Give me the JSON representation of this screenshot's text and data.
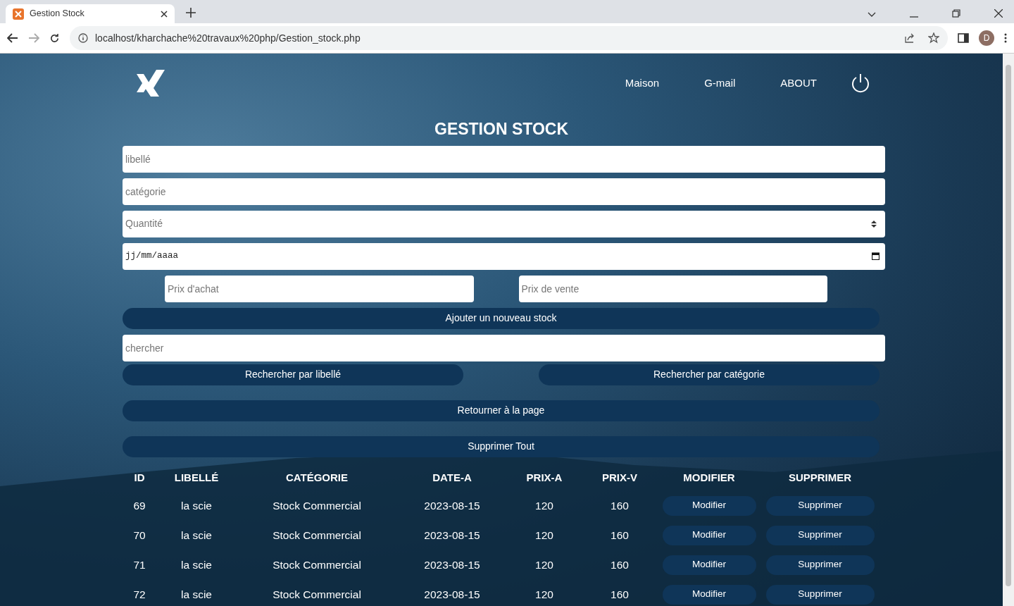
{
  "browser": {
    "tab_title": "Gestion Stock",
    "url": "localhost/kharchache%20travaux%20php/Gestion_stock.php",
    "profile_initial": "D"
  },
  "nav": {
    "links": [
      "Maison",
      "G-mail",
      "ABOUT"
    ]
  },
  "title": "GESTION STOCK",
  "fields": [
    {
      "kind": "text",
      "placeholder": "libellé"
    },
    {
      "kind": "text",
      "placeholder": "catégorie"
    },
    {
      "kind": "number",
      "placeholder": "Quantité"
    },
    {
      "kind": "date",
      "placeholder": "jj/mm/aaaa"
    }
  ],
  "price_fields": [
    {
      "placeholder": "Prix d'achat"
    },
    {
      "placeholder": "Prix de vente"
    }
  ],
  "add_button": "Ajouter un nouveau stock",
  "search": {
    "placeholder": "chercher"
  },
  "search_buttons": [
    "Rechercher par libellé",
    "Rechercher par catégorie"
  ],
  "return_button": "Retourner à la page",
  "delete_all_button": "Supprimer Tout",
  "table": {
    "columns": [
      "ID",
      "LIBELLÉ",
      "CATÉGORIE",
      "DATE-A",
      "PRIX-A",
      "PRIX-V",
      "MODIFIER",
      "SUPPRIMER"
    ],
    "rows": [
      {
        "id": "69",
        "libelle": "la scie",
        "categorie": "Stock Commercial",
        "date": "2023-08-15",
        "prix_a": "120",
        "prix_v": "160",
        "edit": "Modifier",
        "delete": "Supprimer"
      },
      {
        "id": "70",
        "libelle": "la scie",
        "categorie": "Stock Commercial",
        "date": "2023-08-15",
        "prix_a": "120",
        "prix_v": "160",
        "edit": "Modifier",
        "delete": "Supprimer"
      },
      {
        "id": "71",
        "libelle": "la scie",
        "categorie": "Stock Commercial",
        "date": "2023-08-15",
        "prix_a": "120",
        "prix_v": "160",
        "edit": "Modifier",
        "delete": "Supprimer"
      },
      {
        "id": "72",
        "libelle": "la scie",
        "categorie": "Stock Commercial",
        "date": "2023-08-15",
        "prix_a": "120",
        "prix_v": "160",
        "edit": "Modifier",
        "delete": "Supprimer"
      }
    ]
  }
}
